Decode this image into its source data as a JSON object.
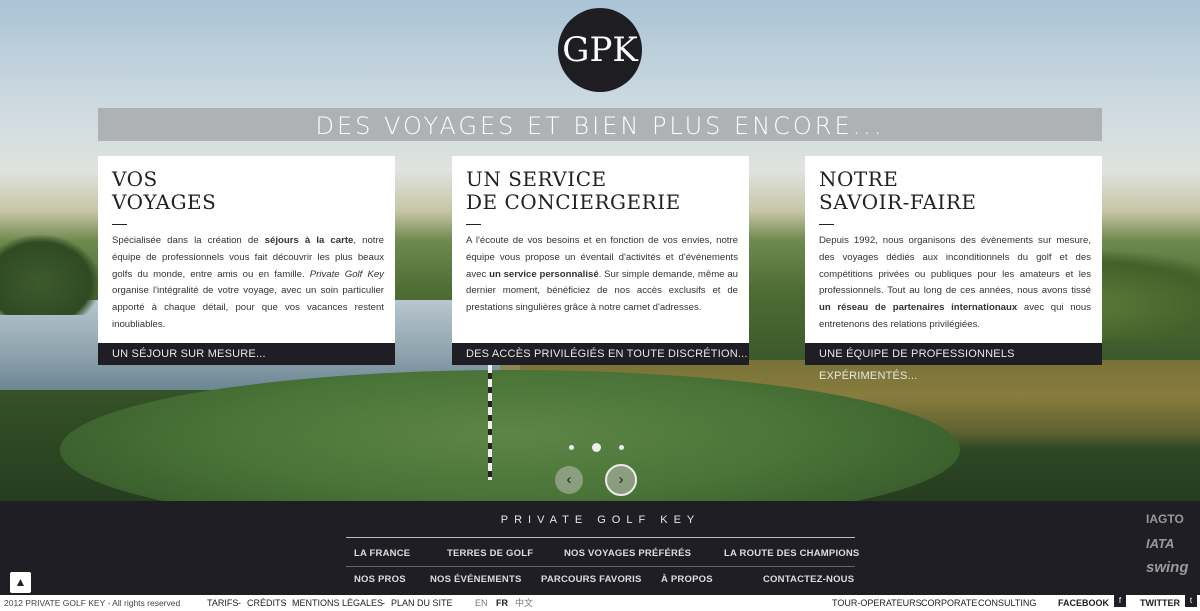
{
  "logo": {
    "letters": "GPK"
  },
  "banner": {
    "text": "DES VOYAGES ET BIEN PLUS ENCORE..."
  },
  "cards": [
    {
      "title_lines": [
        "VOS",
        "VOYAGES"
      ],
      "text": {
        "p1": "Spécialisée dans la création de ",
        "b1": "séjours à la carte",
        "p2": ", notre équipe de professionnels vous fait découvrir les plus beaux golfs du monde, entre amis ou en famille. ",
        "i1": "Private Golf Key",
        "p3": " organise l'intégralité de votre voyage, avec un soin particulier apporté à chaque détail, pour que vos vacances restent inoubliables."
      },
      "footer": "UN SÉJOUR SUR MESURE..."
    },
    {
      "title_lines": [
        "UN SERVICE",
        "DE CONCIERGERIE"
      ],
      "text": {
        "p1": "A l'écoute de vos besoins et en fonction de vos envies, notre équipe vous propose un éventail d'activités et d'évènements avec ",
        "b1": "un service personnalisé",
        "p2": ". Sur simple demande, même au dernier moment, bénéficiez de nos accès exclusifs et de prestations singulières grâce à notre carnet d'adresses."
      },
      "footer": "DES ACCÈS PRIVILÉGIÉS EN TOUTE DISCRÉTION..."
    },
    {
      "title_lines": [
        "NOTRE",
        "SAVOIR-FAIRE"
      ],
      "text": {
        "p1": "Depuis 1992, nous organisons des évènements sur mesure, des voyages dédiés aux inconditionnels du golf et des compétitions privées ou publiques pour les amateurs et les professionnels. Tout au long de ces années, nous avons tissé ",
        "b1": "un réseau de partenaires internationaux",
        "p2": " avec qui nous entretenons des relations privilégiées."
      },
      "footer": "UNE ÉQUIPE DE PROFESSIONNELS EXPÉRIMENTÉS..."
    }
  ],
  "slider": {
    "slides": 3,
    "active": 2,
    "prev": "‹",
    "next": "›"
  },
  "nav": {
    "brand": "PRIVATE GOLF KEY",
    "row1": [
      "LA FRANCE",
      "TERRES DE GOLF",
      "NOS VOYAGES PRÉFÉRÉS",
      "LA ROUTE DES CHAMPIONS"
    ],
    "row2": [
      "NOS PROS",
      "NOS ÉVÉNEMENTS",
      "PARCOURS FAVORIS",
      "À PROPOS",
      "CONTACTEZ-NOUS"
    ]
  },
  "partners": [
    "IAGTO",
    "IATA",
    "swing"
  ],
  "to_top": "▲",
  "bottom": {
    "copyright": "2012 PRIVATE GOLF KEY - All rights reserved",
    "links": [
      "TARIFS",
      "CRÉDITS",
      "MENTIONS LÉGALES",
      "PLAN DU SITE"
    ],
    "sep": "-",
    "langs": [
      "EN",
      "FR",
      "中文"
    ],
    "corporate": [
      "TOUR-OPERATEURS",
      "CORPORATE",
      "CONSULTING"
    ],
    "facebook": "FACEBOOK",
    "facebook_icon": "f",
    "twitter": "TWITTER",
    "twitter_icon": "t"
  }
}
